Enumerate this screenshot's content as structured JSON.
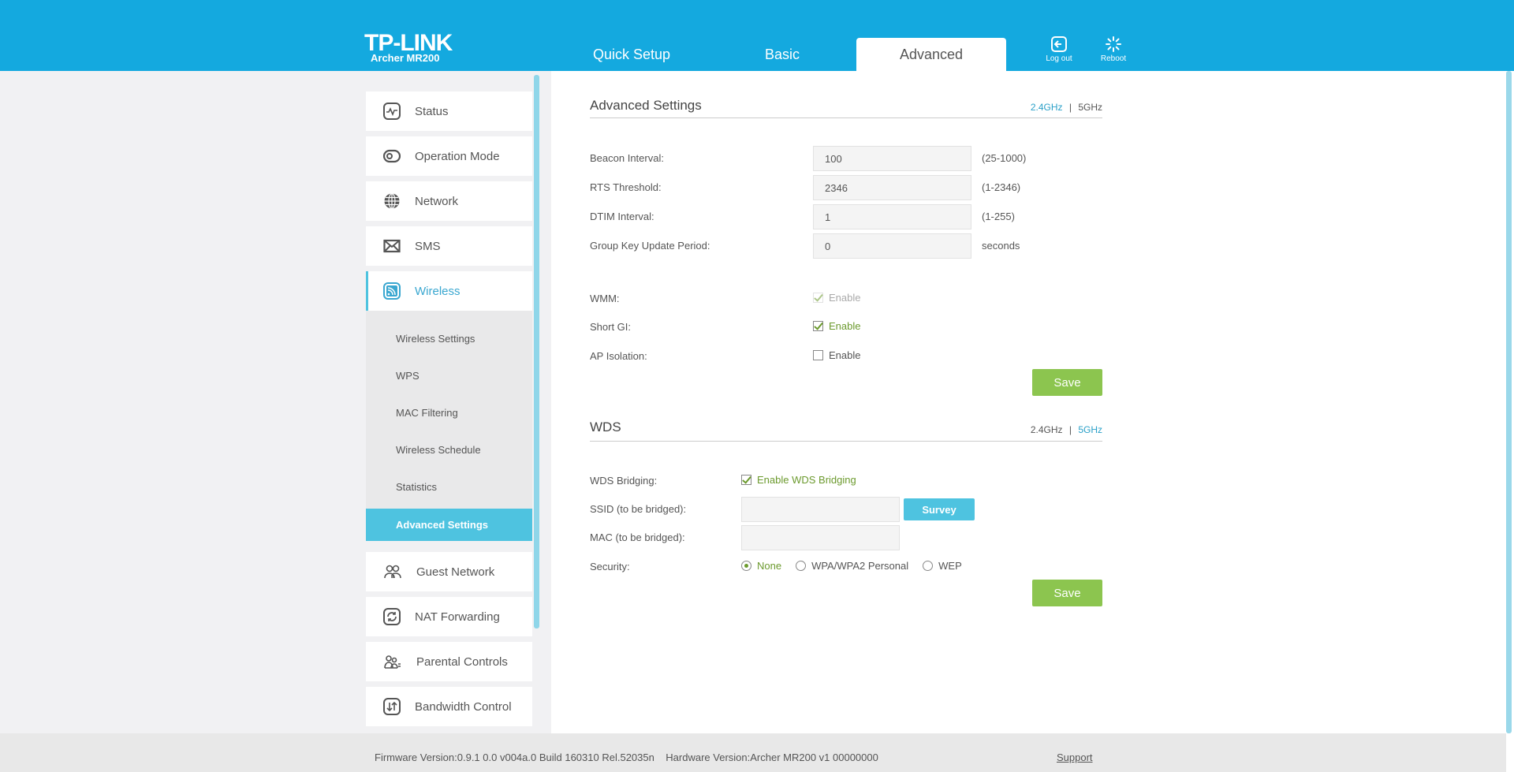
{
  "header": {
    "logo": "TP-LINK",
    "model": "Archer MR200",
    "tabs": [
      {
        "label": "Quick Setup"
      },
      {
        "label": "Basic"
      },
      {
        "label": "Advanced",
        "active": true
      }
    ],
    "logout_label": "Log out",
    "reboot_label": "Reboot",
    "brand_color": "#14a9df"
  },
  "sidebar": {
    "items": [
      {
        "label": "Status",
        "icon": "status-icon"
      },
      {
        "label": "Operation Mode",
        "icon": "operation-mode-icon"
      },
      {
        "label": "Network",
        "icon": "globe-icon"
      },
      {
        "label": "SMS",
        "icon": "envelope-icon"
      },
      {
        "label": "Wireless",
        "icon": "wireless-icon",
        "active": true
      },
      {
        "label": "Guest Network",
        "icon": "guest-network-icon"
      },
      {
        "label": "NAT Forwarding",
        "icon": "nat-forwarding-icon"
      },
      {
        "label": "Parental Controls",
        "icon": "parental-controls-icon"
      },
      {
        "label": "Bandwidth Control",
        "icon": "bandwidth-control-icon"
      }
    ],
    "subitems": [
      {
        "label": "Wireless Settings"
      },
      {
        "label": "WPS"
      },
      {
        "label": "MAC Filtering"
      },
      {
        "label": "Wireless Schedule"
      },
      {
        "label": "Statistics"
      },
      {
        "label": "Advanced Settings",
        "active": true
      }
    ]
  },
  "advanced": {
    "title": "Advanced Settings",
    "band_24": "2.4GHz",
    "band_sep": "|",
    "band_5": "5GHz",
    "active_band": "2.4GHz",
    "beacon_label": "Beacon Interval:",
    "beacon_value": "100",
    "beacon_hint": "(25-1000)",
    "rts_label": "RTS Threshold:",
    "rts_value": "2346",
    "rts_hint": "(1-2346)",
    "dtim_label": "DTIM Interval:",
    "dtim_value": "1",
    "dtim_hint": "(1-255)",
    "gk_label": "Group Key Update Period:",
    "gk_value": "0",
    "gk_hint": "seconds",
    "wmm_label": "WMM:",
    "wmm_option": "Enable",
    "wmm_checked": true,
    "wmm_disabled": true,
    "sgi_label": "Short GI:",
    "sgi_option": "Enable",
    "sgi_checked": true,
    "ap_label": "AP Isolation:",
    "ap_option": "Enable",
    "ap_checked": false,
    "save_label": "Save"
  },
  "wds": {
    "title": "WDS",
    "band_24": "2.4GHz",
    "band_sep": "|",
    "band_5": "5GHz",
    "active_band": "5GHz",
    "bridging_label": "WDS Bridging:",
    "bridging_option": "Enable WDS Bridging",
    "bridging_checked": true,
    "ssid_label": "SSID (to be bridged):",
    "ssid_value": "",
    "survey_label": "Survey",
    "mac_label": "MAC (to be bridged):",
    "mac_value": "",
    "security_label": "Security:",
    "security_options": [
      "None",
      "WPA/WPA2 Personal",
      "WEP"
    ],
    "security_selected": "None",
    "save_label": "Save"
  },
  "footer": {
    "firmware": "Firmware Version:0.9.1 0.0 v004a.0 Build 160310 Rel.52035n",
    "hardware": "Hardware Version:Archer MR200 v1 00000000",
    "support": "Support"
  }
}
